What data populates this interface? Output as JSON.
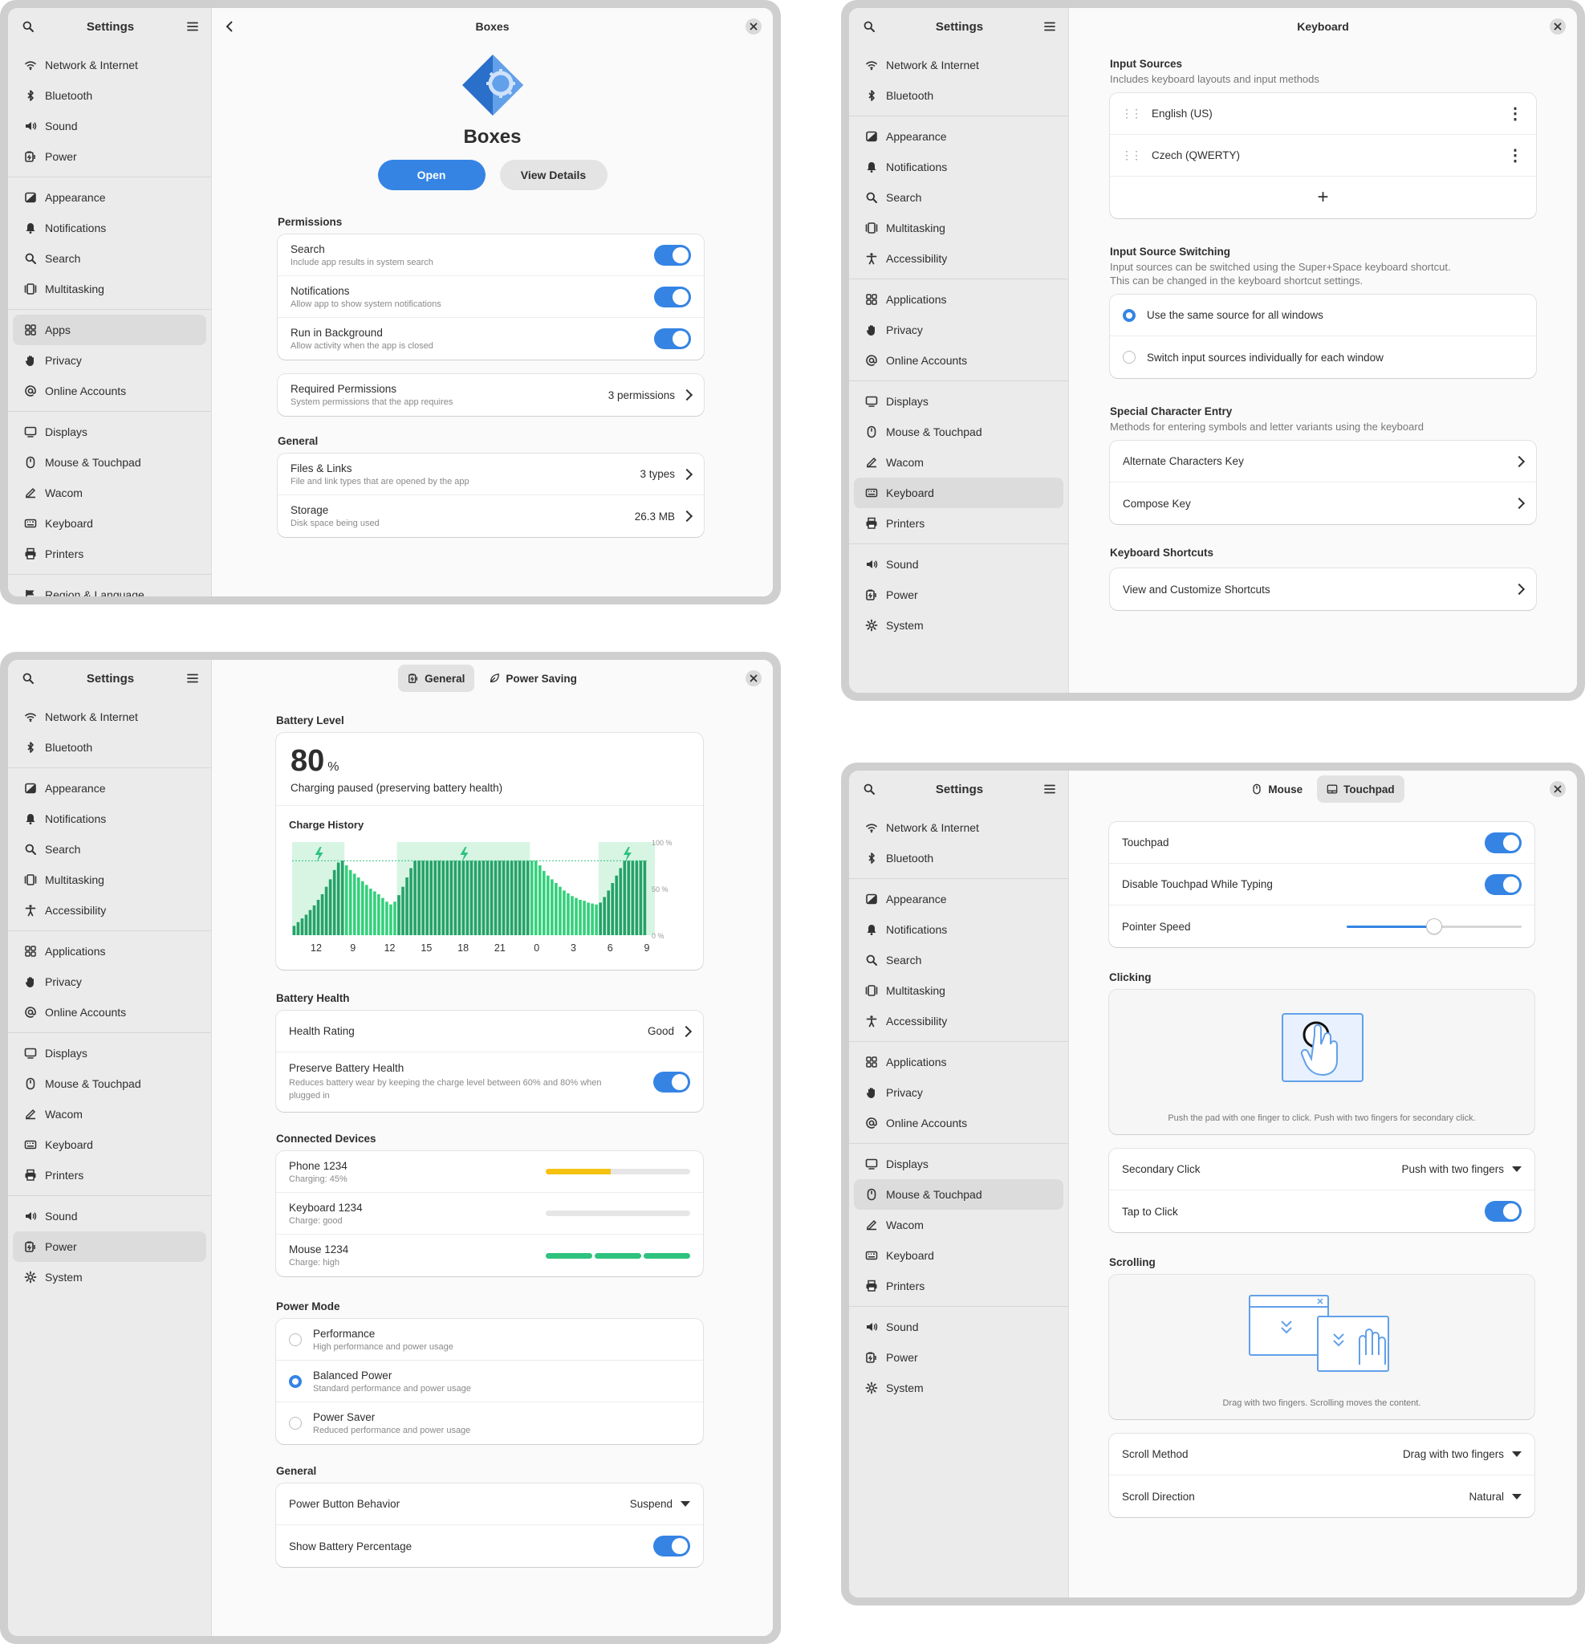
{
  "settings_title": "Settings",
  "w1": {
    "title": "Boxes",
    "app_name": "Boxes",
    "open_label": "Open",
    "details_label": "View Details",
    "sidebar": [
      [
        {
          "label": "Network & Internet",
          "icon": "wifi-icon"
        },
        {
          "label": "Bluetooth",
          "icon": "bluetooth-icon"
        },
        {
          "label": "Sound",
          "icon": "sound-icon"
        },
        {
          "label": "Power",
          "icon": "power-icon"
        }
      ],
      [
        {
          "label": "Appearance",
          "icon": "appearance-icon"
        },
        {
          "label": "Notifications",
          "icon": "bell-icon"
        },
        {
          "label": "Search",
          "icon": "search-icon"
        },
        {
          "label": "Multitasking",
          "icon": "multitasking-icon"
        }
      ],
      [
        {
          "label": "Apps",
          "icon": "apps-icon",
          "selected": true
        },
        {
          "label": "Privacy",
          "icon": "hand-icon"
        },
        {
          "label": "Online Accounts",
          "icon": "at-icon"
        }
      ],
      [
        {
          "label": "Displays",
          "icon": "display-icon"
        },
        {
          "label": "Mouse & Touchpad",
          "icon": "mouse-icon"
        },
        {
          "label": "Wacom",
          "icon": "wacom-icon"
        },
        {
          "label": "Keyboard",
          "icon": "keyboard-icon"
        },
        {
          "label": "Printers",
          "icon": "printer-icon"
        }
      ],
      [
        {
          "label": "Region & Language",
          "icon": "flag-icon"
        }
      ]
    ],
    "permissions_header": "Permissions",
    "permissions": [
      {
        "title": "Search",
        "sub": "Include app results in system search",
        "on": true
      },
      {
        "title": "Notifications",
        "sub": "Allow app to show system notifications",
        "on": true
      },
      {
        "title": "Run in Background",
        "sub": "Allow activity when the app is closed",
        "on": true
      }
    ],
    "required": {
      "title": "Required Permissions",
      "sub": "System permissions that the app requires",
      "value": "3 permissions"
    },
    "general_header": "General",
    "general": [
      {
        "title": "Files & Links",
        "sub": "File and link types that are opened by the app",
        "value": "3 types"
      },
      {
        "title": "Storage",
        "sub": "Disk space being used",
        "value": "26.3 MB"
      }
    ]
  },
  "w2": {
    "title": "Keyboard",
    "sidebar": [
      [
        {
          "label": "Network & Internet",
          "icon": "wifi-icon"
        },
        {
          "label": "Bluetooth",
          "icon": "bluetooth-icon"
        }
      ],
      [
        {
          "label": "Appearance",
          "icon": "appearance-icon"
        },
        {
          "label": "Notifications",
          "icon": "bell-icon"
        },
        {
          "label": "Search",
          "icon": "search-icon"
        },
        {
          "label": "Multitasking",
          "icon": "multitasking-icon"
        },
        {
          "label": "Accessibility",
          "icon": "accessibility-icon"
        }
      ],
      [
        {
          "label": "Applications",
          "icon": "apps-icon"
        },
        {
          "label": "Privacy",
          "icon": "hand-icon"
        },
        {
          "label": "Online Accounts",
          "icon": "at-icon"
        }
      ],
      [
        {
          "label": "Displays",
          "icon": "display-icon"
        },
        {
          "label": "Mouse & Touchpad",
          "icon": "mouse-icon"
        },
        {
          "label": "Wacom",
          "icon": "wacom-icon"
        },
        {
          "label": "Keyboard",
          "icon": "keyboard-icon",
          "selected": true
        },
        {
          "label": "Printers",
          "icon": "printer-icon"
        }
      ],
      [
        {
          "label": "Sound",
          "icon": "sound-icon"
        },
        {
          "label": "Power",
          "icon": "power-icon"
        },
        {
          "label": "System",
          "icon": "gear-icon"
        }
      ]
    ],
    "input_sources_header": "Input Sources",
    "input_sources_sub": "Includes keyboard layouts and input methods",
    "sources": [
      "English (US)",
      "Czech (QWERTY)"
    ],
    "add_label": "+",
    "switching_header": "Input Source Switching",
    "switching_sub1": "Input sources can be switched using the Super+Space keyboard shortcut.",
    "switching_sub2": "This can be changed in the keyboard shortcut settings.",
    "switch_options": [
      {
        "label": "Use the same source for all windows",
        "on": true
      },
      {
        "label": "Switch input sources individually for each window",
        "on": false
      }
    ],
    "special_header": "Special Character Entry",
    "special_sub": "Methods for entering symbols and letter variants using the keyboard",
    "special": [
      "Alternate Characters Key",
      "Compose Key"
    ],
    "shortcuts_header": "Keyboard Shortcuts",
    "shortcuts_row": "View and Customize Shortcuts"
  },
  "w3": {
    "tabs": [
      {
        "label": "General",
        "icon": "power-icon",
        "selected": true
      },
      {
        "label": "Power Saving",
        "icon": "leaf-icon",
        "selected": false
      }
    ],
    "sidebar": [
      [
        {
          "label": "Network & Internet",
          "icon": "wifi-icon"
        },
        {
          "label": "Bluetooth",
          "icon": "bluetooth-icon"
        }
      ],
      [
        {
          "label": "Appearance",
          "icon": "appearance-icon"
        },
        {
          "label": "Notifications",
          "icon": "bell-icon"
        },
        {
          "label": "Search",
          "icon": "search-icon"
        },
        {
          "label": "Multitasking",
          "icon": "multitasking-icon"
        },
        {
          "label": "Accessibility",
          "icon": "accessibility-icon"
        }
      ],
      [
        {
          "label": "Applications",
          "icon": "apps-icon"
        },
        {
          "label": "Privacy",
          "icon": "hand-icon"
        },
        {
          "label": "Online Accounts",
          "icon": "at-icon"
        }
      ],
      [
        {
          "label": "Displays",
          "icon": "display-icon"
        },
        {
          "label": "Mouse & Touchpad",
          "icon": "mouse-icon"
        },
        {
          "label": "Wacom",
          "icon": "wacom-icon"
        },
        {
          "label": "Keyboard",
          "icon": "keyboard-icon"
        },
        {
          "label": "Printers",
          "icon": "printer-icon"
        }
      ],
      [
        {
          "label": "Sound",
          "icon": "sound-icon"
        },
        {
          "label": "Power",
          "icon": "power-icon",
          "selected": true
        },
        {
          "label": "System",
          "icon": "gear-icon"
        }
      ]
    ],
    "battery_level_header": "Battery Level",
    "battery_value": "80",
    "battery_unit": "%",
    "battery_status": "Charging paused (preserving battery health)",
    "charge_history_label": "Charge History",
    "health_header": "Battery Health",
    "health_rating": {
      "title": "Health Rating",
      "value": "Good"
    },
    "preserve": {
      "title": "Preserve Battery Health",
      "sub": "Reduces battery wear by keeping the charge level between 60% and 80% when plugged in",
      "on": true
    },
    "devices_header": "Connected Devices",
    "devices": [
      {
        "name": "Phone 1234",
        "sub": "Charging: 45%",
        "level": 0.45,
        "color": "#f5c211"
      },
      {
        "name": "Keyboard 1234",
        "sub": "Charge: good",
        "level": 0,
        "color": "#e6e6e6"
      },
      {
        "name": "Mouse 1234",
        "sub": "Charge: high",
        "level": 1,
        "color": "#2ec27e"
      }
    ],
    "power_mode_header": "Power Mode",
    "power_modes": [
      {
        "title": "Performance",
        "sub": "High performance and power usage",
        "on": false
      },
      {
        "title": "Balanced Power",
        "sub": "Standard performance and power usage",
        "on": true
      },
      {
        "title": "Power Saver",
        "sub": "Reduced performance and power usage",
        "on": false
      }
    ],
    "general_header": "General",
    "power_button": {
      "title": "Power Button Behavior",
      "value": "Suspend"
    },
    "show_pct": {
      "title": "Show Battery Percentage",
      "on": true
    }
  },
  "w4": {
    "tabs": [
      {
        "label": "Mouse",
        "icon": "mouse-icon",
        "selected": false
      },
      {
        "label": "Touchpad",
        "icon": "touchpad-icon",
        "selected": true
      }
    ],
    "sidebar": [
      [
        {
          "label": "Network & Internet",
          "icon": "wifi-icon"
        },
        {
          "label": "Bluetooth",
          "icon": "bluetooth-icon"
        }
      ],
      [
        {
          "label": "Appearance",
          "icon": "appearance-icon"
        },
        {
          "label": "Notifications",
          "icon": "bell-icon"
        },
        {
          "label": "Search",
          "icon": "search-icon"
        },
        {
          "label": "Multitasking",
          "icon": "multitasking-icon"
        },
        {
          "label": "Accessibility",
          "icon": "accessibility-icon"
        }
      ],
      [
        {
          "label": "Applications",
          "icon": "apps-icon"
        },
        {
          "label": "Privacy",
          "icon": "hand-icon"
        },
        {
          "label": "Online Accounts",
          "icon": "at-icon"
        }
      ],
      [
        {
          "label": "Displays",
          "icon": "display-icon"
        },
        {
          "label": "Mouse & Touchpad",
          "icon": "mouse-icon",
          "selected": true
        },
        {
          "label": "Wacom",
          "icon": "wacom-icon"
        },
        {
          "label": "Keyboard",
          "icon": "keyboard-icon"
        },
        {
          "label": "Printers",
          "icon": "printer-icon"
        }
      ],
      [
        {
          "label": "Sound",
          "icon": "sound-icon"
        },
        {
          "label": "Power",
          "icon": "power-icon"
        },
        {
          "label": "System",
          "icon": "gear-icon"
        }
      ]
    ],
    "touchpad": {
      "title": "Touchpad",
      "on": true
    },
    "disable_typing": {
      "title": "Disable Touchpad While Typing",
      "on": true
    },
    "pointer_speed": {
      "title": "Pointer Speed",
      "level": 0.5
    },
    "clicking_header": "Clicking",
    "clicking_caption": "Push the pad with one finger to click. Push with two fingers for secondary click.",
    "secondary_click": {
      "title": "Secondary Click",
      "value": "Push with two fingers"
    },
    "tap_click": {
      "title": "Tap to Click",
      "on": true
    },
    "scrolling_header": "Scrolling",
    "scrolling_caption": "Drag with two fingers. Scrolling moves the content.",
    "scroll_method": {
      "title": "Scroll Method",
      "value": "Drag with two fingers"
    },
    "scroll_direction": {
      "title": "Scroll Direction",
      "value": "Natural"
    }
  },
  "chart_data": {
    "type": "bar",
    "title": "Charge History",
    "categories": [
      "12",
      "9",
      "12",
      "15",
      "18",
      "21",
      "0",
      "3",
      "6",
      "9"
    ],
    "y_ticks": [
      "100 %",
      "50 %",
      "0 %"
    ],
    "ylim": [
      0,
      100
    ],
    "values": [
      10,
      14,
      18,
      22,
      27,
      32,
      38,
      44,
      52,
      60,
      70,
      78,
      80,
      75,
      70,
      66,
      62,
      58,
      54,
      50,
      47,
      44,
      40,
      36,
      33,
      36,
      43,
      52,
      62,
      72,
      80,
      80,
      80,
      80,
      80,
      80,
      80,
      80,
      80,
      80,
      80,
      80,
      80,
      80,
      80,
      80,
      80,
      80,
      80,
      80,
      80,
      80,
      80,
      80,
      80,
      80,
      80,
      80,
      80,
      80,
      80,
      75,
      69,
      64,
      60,
      56,
      52,
      48,
      45,
      42,
      40,
      38,
      37,
      35,
      34,
      33,
      35,
      41,
      48,
      56,
      64,
      72,
      80,
      80,
      80,
      80,
      80,
      80
    ],
    "charging_windows": [
      [
        0,
        13
      ],
      [
        26,
        59
      ],
      [
        76,
        90
      ]
    ],
    "limit_line": 80
  }
}
